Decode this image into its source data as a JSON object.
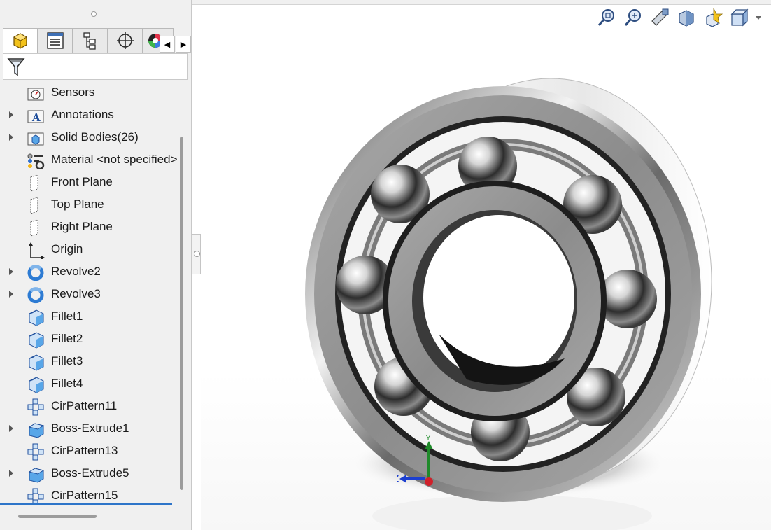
{
  "feature_tree": {
    "tabs": [
      {
        "name": "featuremanager-icon",
        "active": true
      },
      {
        "name": "property-manager-icon",
        "active": false
      },
      {
        "name": "configuration-manager-icon",
        "active": false
      },
      {
        "name": "dimxpert-icon",
        "active": false
      },
      {
        "name": "display-manager-icon",
        "active": false
      }
    ],
    "scroll_left": "◀",
    "scroll_right": "▶",
    "items": [
      {
        "label": "Sensors",
        "icon": "sensor-folder-icon",
        "expandable": false
      },
      {
        "label": "Annotations",
        "icon": "annotations-folder-icon",
        "expandable": true
      },
      {
        "label": "Solid Bodies(26)",
        "icon": "solid-bodies-folder-icon",
        "expandable": true
      },
      {
        "label": "Material <not specified>",
        "icon": "material-icon",
        "expandable": false
      },
      {
        "label": "Front Plane",
        "icon": "plane-icon",
        "expandable": false
      },
      {
        "label": "Top Plane",
        "icon": "plane-icon",
        "expandable": false
      },
      {
        "label": "Right Plane",
        "icon": "plane-icon",
        "expandable": false
      },
      {
        "label": "Origin",
        "icon": "origin-icon",
        "expandable": false
      },
      {
        "label": "Revolve2",
        "icon": "revolve-icon",
        "expandable": true
      },
      {
        "label": "Revolve3",
        "icon": "revolve-icon",
        "expandable": true
      },
      {
        "label": "Fillet1",
        "icon": "fillet-icon",
        "expandable": false
      },
      {
        "label": "Fillet2",
        "icon": "fillet-icon",
        "expandable": false
      },
      {
        "label": "Fillet3",
        "icon": "fillet-icon",
        "expandable": false
      },
      {
        "label": "Fillet4",
        "icon": "fillet-icon",
        "expandable": false
      },
      {
        "label": "CirPattern11",
        "icon": "circular-pattern-icon",
        "expandable": false
      },
      {
        "label": "Boss-Extrude1",
        "icon": "boss-extrude-icon",
        "expandable": true
      },
      {
        "label": "CirPattern13",
        "icon": "circular-pattern-icon",
        "expandable": false
      },
      {
        "label": "Boss-Extrude5",
        "icon": "boss-extrude-icon",
        "expandable": true
      },
      {
        "label": "CirPattern15",
        "icon": "circular-pattern-icon",
        "expandable": false
      }
    ]
  },
  "heads_up_toolbar": [
    {
      "name": "zoom-to-fit-icon"
    },
    {
      "name": "zoom-to-area-icon"
    },
    {
      "name": "previous-view-icon"
    },
    {
      "name": "section-view-icon"
    },
    {
      "name": "view-orientation-icon"
    },
    {
      "name": "display-style-icon"
    }
  ],
  "triad": {
    "y": "Y",
    "z": "Z"
  },
  "colors": {
    "accent": "#2e75c9",
    "panel": "#f0f0f0",
    "triad_y": "#1f8a2a",
    "triad_z": "#1c3fd0",
    "triad_x": "#d0202a"
  }
}
